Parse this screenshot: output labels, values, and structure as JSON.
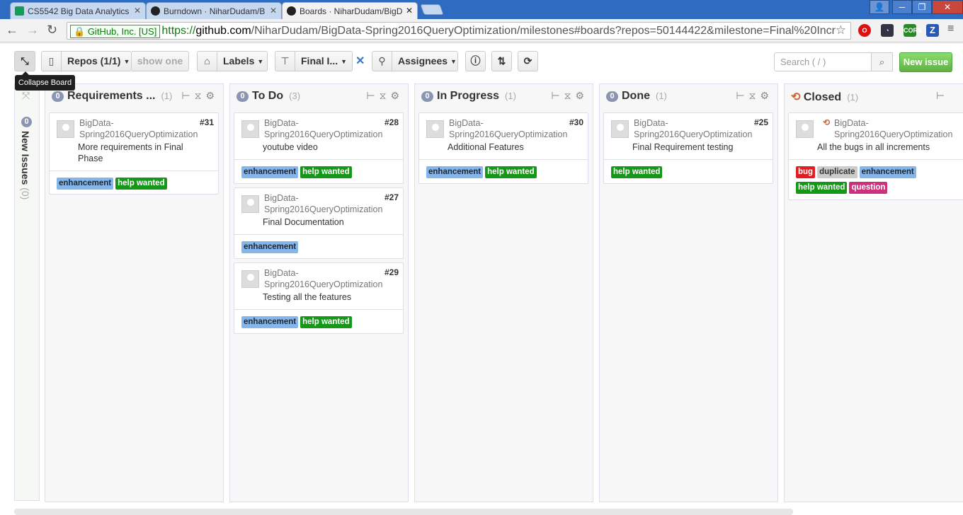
{
  "browser": {
    "tabs": [
      {
        "title": "CS5542 Big Data Analytics"
      },
      {
        "title": "Burndown · NiharDudam/B"
      },
      {
        "title": "Boards · NiharDudam/BigD"
      }
    ],
    "ev_label": "GitHub, Inc. [US]",
    "url_scheme": "https://",
    "url_host": "github.com",
    "url_rest": "/NiharDudam/BigData-Spring2016QueryOptimization/milestones#boards?repos=50144422&milestone=Final%20Incr"
  },
  "toolbar": {
    "repos_label": "Repos (1/1)",
    "show_one_label": "show one",
    "labels_label": "Labels",
    "milestone_label": "Final I...",
    "assignees_label": "Assignees",
    "search_placeholder": "Search ( / )",
    "new_issue_label": "New issue",
    "tooltip": "Collapse Board"
  },
  "new_issues": {
    "count": "0",
    "label": "New Issues",
    "sub": "(0)"
  },
  "columns": [
    {
      "title": "Requirements ...",
      "count_badge": "0",
      "count": "(1)",
      "cards": [
        {
          "repo": "BigData-Spring2016QueryOptimization",
          "number": "#31",
          "title": "More requirements in Final Phase",
          "labels": [
            "enhancement",
            "help wanted"
          ]
        }
      ]
    },
    {
      "title": "To Do",
      "count_badge": "0",
      "count": "(3)",
      "cards": [
        {
          "repo": "BigData-Spring2016QueryOptimization",
          "number": "#28",
          "title": "youtube video",
          "labels": [
            "enhancement",
            "help wanted"
          ]
        },
        {
          "repo": "BigData-Spring2016QueryOptimization",
          "number": "#27",
          "title": "Final Documentation",
          "labels": [
            "enhancement"
          ]
        },
        {
          "repo": "BigData-Spring2016QueryOptimization",
          "number": "#29",
          "title": "Testing all the features",
          "labels": [
            "enhancement",
            "help wanted"
          ]
        }
      ]
    },
    {
      "title": "In Progress",
      "count_badge": "0",
      "count": "(1)",
      "cards": [
        {
          "repo": "BigData-Spring2016QueryOptimization",
          "number": "#30",
          "title": "Additional Features",
          "labels": [
            "enhancement",
            "help wanted"
          ]
        }
      ]
    },
    {
      "title": "Done",
      "count_badge": "0",
      "count": "(1)",
      "cards": [
        {
          "repo": "BigData-Spring2016QueryOptimization",
          "number": "#25",
          "title": "Final Requirement testing",
          "labels": [
            "help wanted"
          ]
        }
      ]
    },
    {
      "title": "Closed",
      "count": "(1)",
      "cards": [
        {
          "repo": "BigData-Spring2016QueryOptimization",
          "title": "All the bugs in all increments",
          "labels": [
            "bug",
            "duplicate",
            "enhancement",
            "help wanted",
            "question"
          ]
        }
      ]
    }
  ],
  "colors": {
    "enhancement": "#84b6eb",
    "help_wanted": "#159818",
    "bug": "#e11d21",
    "duplicate": "#cccccc",
    "question": "#cc317c",
    "new_issue": "#60b044"
  }
}
